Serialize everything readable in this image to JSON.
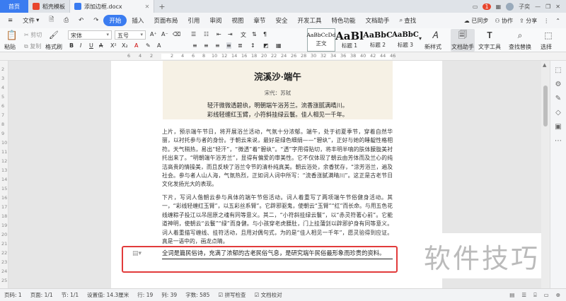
{
  "titlebar": {
    "home_tab": "首页",
    "tabs": [
      {
        "label": "稻壳模板",
        "logo_color": "#e8452c"
      },
      {
        "label": "添加边框.docx",
        "logo_color": "#3b7cf0"
      }
    ],
    "add_tab": "+",
    "window_badge": "1",
    "user_name": "子奕"
  },
  "menubar": {
    "file": "文件",
    "items": [
      "开始",
      "插入",
      "页面布局",
      "引用",
      "审阅",
      "视图",
      "章节",
      "安全",
      "开发工具",
      "特色功能",
      "文档助手"
    ],
    "active": "开始",
    "search": "查找",
    "sync": "已同步",
    "collaborate": "协作",
    "share": "分享"
  },
  "ribbon": {
    "paste": "粘贴",
    "cut": "剪切",
    "copy": "复制",
    "format_painter": "格式刷",
    "font_name": "宋体",
    "font_size": "五号",
    "styles": [
      {
        "preview": "AaBbCcDd",
        "label": "正文"
      },
      {
        "preview": "AaBl",
        "label": "标题 1"
      },
      {
        "preview": "AaBbC",
        "label": "标题 2"
      },
      {
        "preview": "AaBbC",
        "label": "标题 3"
      }
    ],
    "new_style": "新样式",
    "doc_helper": "文档助手",
    "text_tools": "文字工具",
    "find_replace": "查找替换",
    "select": "选择"
  },
  "ruler": {
    "ticks": [
      "6",
      "4",
      "2",
      "2",
      "4",
      "6",
      "8",
      "10",
      "12",
      "14",
      "16",
      "18",
      "20",
      "22",
      "24",
      "26",
      "28",
      "30",
      "32",
      "34",
      "36",
      "38",
      "40",
      "42",
      "44",
      "46"
    ],
    "vticks": [
      "2",
      "3",
      "4",
      "5",
      "6",
      "7",
      "8",
      "9",
      "10",
      "11",
      "12",
      "13",
      "14",
      "15",
      "16",
      "17",
      "18",
      "19",
      "20",
      "21",
      "22",
      "23",
      "24",
      "25"
    ]
  },
  "document": {
    "poem_title": "浣溪沙·端午",
    "poem_author": "宋代：苏轼",
    "poem_lines": [
      "轻汗微微透碧纨，明朝端午浴芳兰。流香涨腻满晴川。",
      "彩线轻缠红玉臂，小符斜挂绿云鬟。佳人相见一千年。"
    ],
    "para1": "上片，预示端午节日，将开展浴兰活动，气氛十分浓郁。端午，处于初夏季节，穿着自然华丽，以衬托参与者的身份。于朝云来说，最好是绿色细绢——“碧纨”，正好与她的睡靛性格相符。天气稍热，易出“轻汗”，“微透”着“碧纨”。“透”字用得贴切，将丰明半嗔的肤体朦胧美衬托出来了。“明朝端午浴芳兰”，显得有偏爱的审美性。它不仅体现了朝云由芳体而及兰心的纯洁高贵的情操美，而且反映了浴兰令节的清朴纯真美。朝云浴处，余香犹存，“涂芳浴兰，遍及社会。参与者人山人海，气氛热烈，正如词人词中所写：“流香涨腻满晴川”。这正是古老节日文化发扬光大的表现。",
    "para2": "下片，写词人偕朝云参与具体的端午节俗活动。词人着重写了两项端午节俗健身活动。其一，“彩线轻缠红玉臂”，以五彩丝系臂”。它辟邪驱鬼，使朝云“玉臂”“红”而长命。与用五色花线缠粽子投江以吊屈原之魂有同等意义。其二，“小符斜挂绿云鬟”，以“赤灵符著心前”。它能道神明，使朝云“云鬟”“绿”而身健。与小孩穿老虎腰肚，门上挂蒲剑以辟邪护身有同等意义。词人着重描写缠线、挂符活动，且用对偶句式，为的是“佳人相见一千年”，愿灵验得到应证。真是一语中的，画龙点睛。",
    "last_line": "全词是篇民俗诗，充满了浓郁的古老民俗气息，是研究端午民俗最形象而珍贵的资料。"
  },
  "watermark": "软件技巧",
  "statusbar": {
    "page": "页码: 1",
    "pages": "页面: 1/1",
    "section": "节: 1/1",
    "position": "设置值: 14.3厘米",
    "line": "行: 19",
    "column": "列: 39",
    "words": "字数: 585",
    "spell": "拼写检查",
    "proofread": "文档校对"
  },
  "colors": {
    "accent": "#3b7cf0",
    "highlight_border": "#e23b3b",
    "quote_bg": "#f6f1e5"
  }
}
